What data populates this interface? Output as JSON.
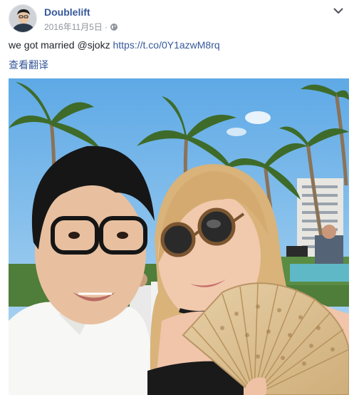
{
  "post": {
    "author": "Doublelift",
    "timestamp": "2016年11月5日",
    "separator": "·",
    "privacy_icon": "globe-icon",
    "menu_icon": "chevron-down-icon",
    "text": "we got married @sjokz ",
    "link": "https://t.co/0Y1azwM8rq",
    "translate_label": "查看翻译"
  },
  "colors": {
    "link": "#365899",
    "meta": "#90949c",
    "text": "#1d2129"
  }
}
